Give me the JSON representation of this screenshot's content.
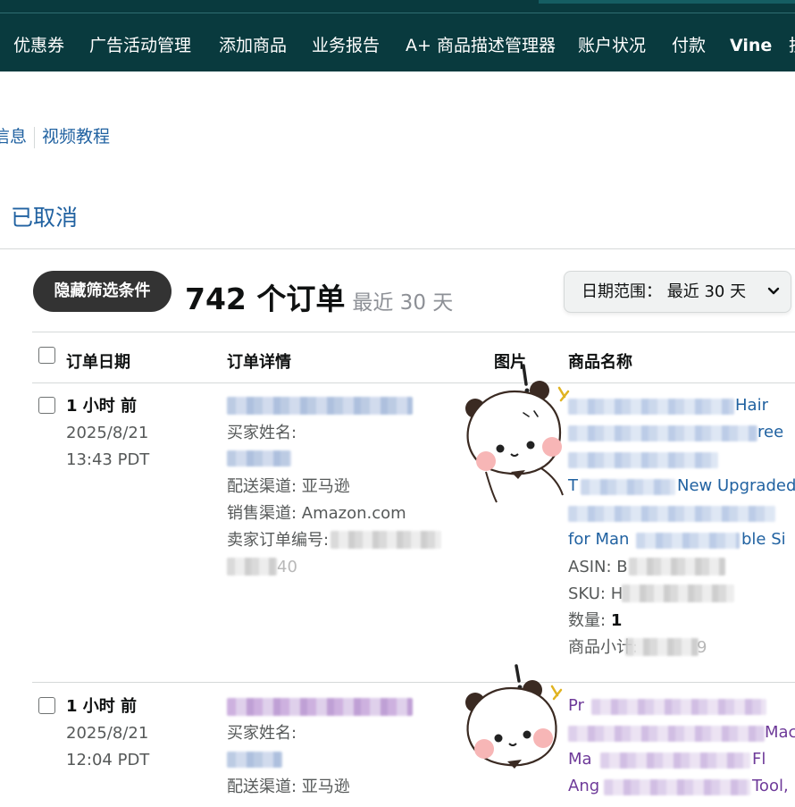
{
  "nav": {
    "items": [
      "优惠券",
      "广告活动管理",
      "添加商品",
      "业务报告",
      "A+ 商品描述管理器",
      "账户状况",
      "付款",
      "Vine",
      "技"
    ]
  },
  "sublinks": {
    "info": "信息",
    "video": "视频教程"
  },
  "tabs": {
    "cancelled": "已取消"
  },
  "filter": {
    "hide_button": "隐藏筛选条件",
    "count": "742 个订单",
    "range_note": "最近 30 天",
    "date_range_label": "日期范围： 最近 30 天"
  },
  "table": {
    "headers": {
      "order_date": "订单日期",
      "order_details": "订单详情",
      "image": "图片",
      "product_name": "商品名称"
    },
    "rows": [
      {
        "age": "1 小时 前",
        "date": "2025/8/21",
        "time": "13:43 PDT",
        "buyer_label": "买家姓名:",
        "fulfillment": "配送渠道: 亚马逊",
        "sales_channel": "销售渠道: Amazon.com",
        "seller_order_label": "卖家订单编号:",
        "seller_order_tail": "40",
        "title_fragments": [
          "Hair",
          "ree",
          "T",
          "New Upgraded",
          "for Man",
          "ble Si"
        ],
        "asin_label": "ASIN: B",
        "sku_label": "SKU: H",
        "qty_label": "数量:",
        "qty_value": "1",
        "subtotal_label": "商品小计:",
        "subtotal_tail": "9"
      },
      {
        "age": "1 小时 前",
        "date": "2025/8/21",
        "time": "12:04 PDT",
        "buyer_label": "买家姓名:",
        "fulfillment": "配送渠道: 亚马逊",
        "title_fragments": [
          "Pr",
          "Mac",
          "Ma",
          "Fl",
          "Ang",
          "Tool,"
        ]
      }
    ]
  },
  "colors": {
    "nav_bg": "#093a3e",
    "link": "#2162a1",
    "visited_link": "#6e3a99",
    "button_dark": "#333333"
  }
}
